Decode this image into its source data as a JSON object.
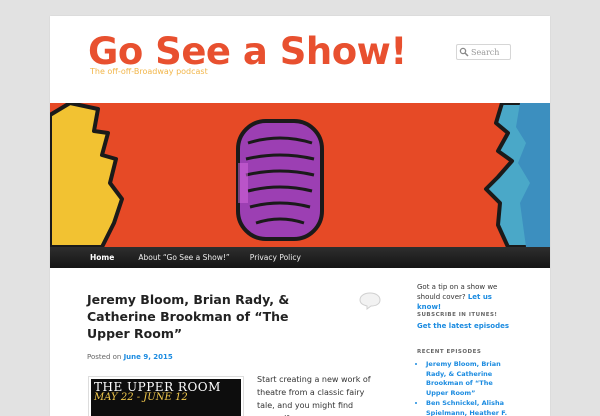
{
  "site": {
    "title": "Go See a Show!",
    "description": "The off-off-Broadway podcast"
  },
  "search": {
    "placeholder": "Search"
  },
  "nav": {
    "items": [
      {
        "label": "Home"
      },
      {
        "label": "About “Go See a Show!”"
      },
      {
        "label": "Privacy Policy"
      }
    ]
  },
  "post": {
    "title": "Jeremy Bloom, Brian Rady, & Catherine Brookman of “The Upper Room”",
    "posted_prefix": "Posted on",
    "date": "June 9, 2015",
    "poster_title": "THE UPPER ROOM",
    "poster_dates": "MAY 22 - JUNE 12",
    "excerpt": "Start creating a new work of theatre from a classic fairy tale, and you might find yourself"
  },
  "sidebar": {
    "tip_text": "Got a tip on a show we should cover?",
    "tip_link": "Let us know!",
    "itunes_title": "SUBSCRIBE IN ITUNES!",
    "itunes_link": "Get the latest episodes",
    "recent_title": "RECENT EPISODES",
    "recent": [
      "Jeremy Bloom, Brian Rady, & Catherine Brookman of “The Upper Room”",
      "Ben Schnickel, Alisha Spielmann, Heather F."
    ]
  },
  "colors": {
    "accent_title": "#e8502f",
    "tagline": "#f2b64a",
    "link": "#1b8be0",
    "nav_bg": "#222222"
  },
  "icons": {
    "search": "search-icon",
    "comment": "comment-bubble-icon"
  }
}
